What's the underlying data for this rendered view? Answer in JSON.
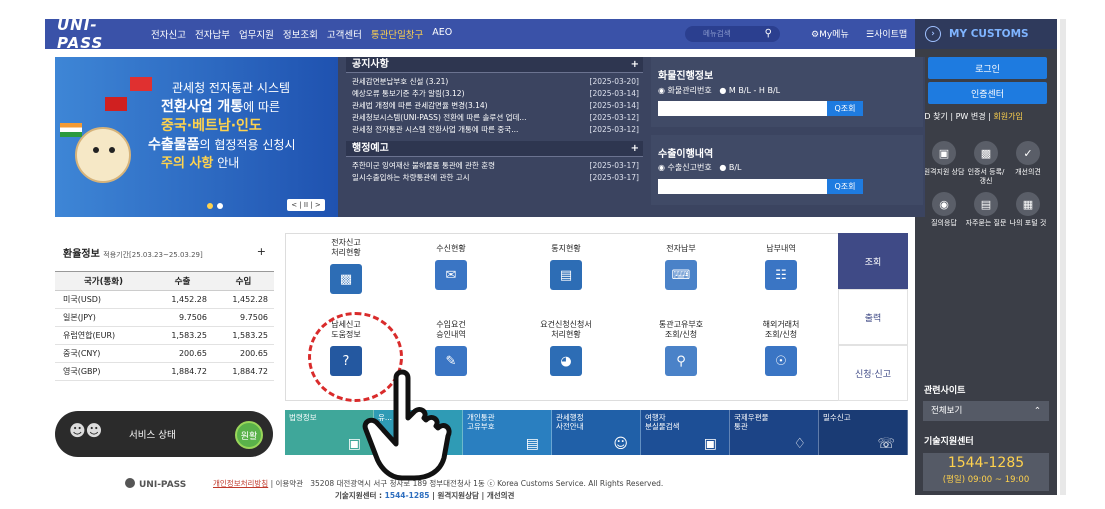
{
  "header": {
    "logo": "UNI-PASS",
    "nav": [
      "전자신고",
      "전자납부",
      "업무지원",
      "정보조회",
      "고객센터",
      "통관단일창구",
      "AEO"
    ],
    "search_placeholder": "메뉴검색",
    "mymenu": "My메뉴",
    "sitemap": "사이트맵"
  },
  "banner": {
    "line1": "관세청 전자통관 시스템",
    "line2a": "전환사업 개통",
    "line2b": "에 따른",
    "line3": "중국·베트남·인도",
    "line4a": "수출물품",
    "line4b": "의 협정적용 신청시",
    "line5a": "주의 사항",
    "line5b": " 안내",
    "pager": "< | II | >"
  },
  "notice": {
    "title": "공지사항",
    "more": "+",
    "items": [
      {
        "text": "관세감면분납부호 신설 (3.21)",
        "date": "[2025-03-20]"
      },
      {
        "text": "예상오류 통보기준 추가 알림(3.12)",
        "date": "[2025-03-14]"
      },
      {
        "text": "관세법 개정에 따른 관세감면율 변경(3.14)",
        "date": "[2025-03-14]"
      },
      {
        "text": "관세청보시스템(UNI-PASS) 전환에 따른 솔루션 업데...",
        "date": "[2025-03-12]"
      },
      {
        "text": "관세청 전자통관 시스템 전환사업 개통에 따른 중국...",
        "date": "[2025-03-12]"
      }
    ],
    "admin_title": "행정예고",
    "admin_more": "+",
    "admin_items": [
      {
        "text": "주한미군 잉여재산 불하물품 통관에 관한 훈령",
        "date": "[2025-03-17]"
      },
      {
        "text": "일시수출입하는 차량통관에 관한 고시",
        "date": "[2025-03-17]"
      }
    ]
  },
  "cargo": {
    "title": "화물진행정보",
    "opt1": "화물관리번호",
    "opt2": "M B/L - H B/L",
    "button": "Q조회"
  },
  "export": {
    "title": "수출이행내역",
    "opt1": "수출신고번호",
    "opt2": "B/L",
    "button": "Q조회"
  },
  "right": {
    "header": "MY CUSTOMS",
    "login": "로그인",
    "cert": "인증센터",
    "id_find": "ID 찾기",
    "pw_change": "PW 변경",
    "join": "회원가입",
    "icons": [
      "원격지원 상담",
      "인증서 등록/갱신",
      "개선의견",
      "질의응답",
      "자주묻는 질문",
      "나의 포털 것"
    ],
    "related": "관련사이트",
    "related_select": "전체보기",
    "tech": "기술지원센터",
    "tech_phone": "1544-1285",
    "tech_hours": "(평일) 09:00 ~ 19:00"
  },
  "fx": {
    "title": "환율정보",
    "period": "적용기간[25.03.23~25.03.29]",
    "more": "+",
    "headers": [
      "국가(통화)",
      "수출",
      "수입"
    ],
    "rows": [
      [
        "미국(USD)",
        "1,452.28",
        "1,452.28"
      ],
      [
        "일본(JPY)",
        "9.7506",
        "9.7506"
      ],
      [
        "유럽연합(EUR)",
        "1,583.25",
        "1,583.25"
      ],
      [
        "중국(CNY)",
        "200.65",
        "200.65"
      ],
      [
        "영국(GBP)",
        "1,884.72",
        "1,884.72"
      ]
    ]
  },
  "service": {
    "label": "서비스 상태",
    "status": "원활"
  },
  "grid": {
    "row1": [
      "전자신고\n처리현황",
      "수신현황",
      "통지현황",
      "전자납부",
      "납부내역"
    ],
    "row2": [
      "납세신고\n도움정보",
      "수입요건\n승인내역",
      "요건신청신청서\n처리현황",
      "통관고유부호\n조회/신청",
      "해외거래처\n조회/신청"
    ]
  },
  "tabs": [
    "조회",
    "출력",
    "신청·신고"
  ],
  "links": [
    {
      "label": "법령정보",
      "color": "#3fa79a"
    },
    {
      "label": "유...",
      "color": "#2f9bb5"
    },
    {
      "label": "개인통관\n고유부호",
      "color": "#2a7fc0"
    },
    {
      "label": "관세행정\n사전안내",
      "color": "#2060a8"
    },
    {
      "label": "여행자\n분실물검색",
      "color": "#1d4f96"
    },
    {
      "label": "국제우편물\n통관",
      "color": "#1c4486"
    },
    {
      "label": "밀수신고",
      "color": "#1a3b74"
    }
  ],
  "footer": {
    "brand": "UNI-PASS",
    "privacy": "개인정보처리방침",
    "terms": "이용약관",
    "address": "35208 대전광역시 서구 청사로 189 정부대전청사 1동 ⓒ Korea Customs Service. All Rights Reserved.",
    "tech_label": "기술지원센터 :",
    "tech_phone": "1544-1285",
    "remote": "원격지원상담",
    "feedback": "개선의견"
  }
}
